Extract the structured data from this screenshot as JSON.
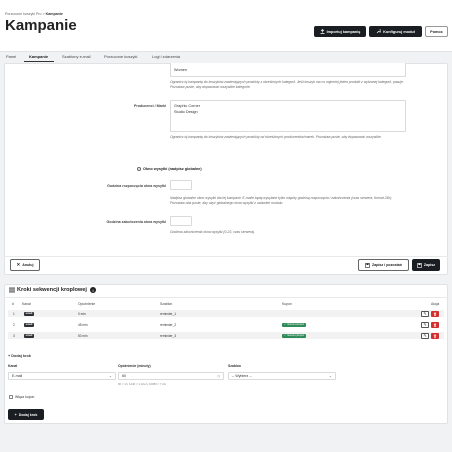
{
  "breadcrumb": {
    "parent": "Porzucone koszyki Pro",
    "separator": ">",
    "current": "Kampanie"
  },
  "page_title": "Kampanie",
  "header_buttons": {
    "import": "Importuj kampanię",
    "configure": "Konfiguruj moduł",
    "help": "Pomoc"
  },
  "tabs": [
    "Panel",
    "Kampanie",
    "Szablony e-mail",
    "Porzucone koszyki",
    "Logi i zdarzenia"
  ],
  "active_tab": 1,
  "form": {
    "categories_value": "Women",
    "categories_help": "Ogranicz tę kampanię do koszyków zawierających produkty z określonych kategorii. Jeśli koszyk ma co najmniej jeden produkt z wybranej kategorii, pasuje. Pozostaw puste, aby dopasować wszystkie kategorie.",
    "manufacturers_label": "Producenci / Marki",
    "manufacturers_values": [
      "Graphic Corner",
      "Studio Design"
    ],
    "manufacturers_help": "Ogranicz tę kampanię do koszyków zawierających produkty od określonych producentów/marek. Pozostaw puste, aby dopasować wszystkie.",
    "send_window_label": "Okno wysyłki (nadpisz globalne)",
    "start_label": "Godzina rozpoczęcia okna wysyłki",
    "start_help": "Nadpisz globalne okno wysyłki dla tej kampanii. E-maile będą wysyłane tylko między godziną rozpoczęcia i zakończenia (czas serwera, format 24h). Pozostaw oba puste, aby użyć globalnego okna wysyłki z ustawień modułu.",
    "end_label": "Godzina zakończenia okna wysyłki",
    "end_help": "Godzina zakończenia okna wysyłki (0-23, czas serwera).",
    "cancel": "Anuluj",
    "save_stay": "Zapisz i pozostań",
    "save": "Zapisz"
  },
  "drip": {
    "title": "Kroki sekwencji kroplowej",
    "columns": [
      "#",
      "Kanał",
      "Opóźnienie",
      "Szablon",
      "Kupon",
      "Akcja"
    ],
    "rows": [
      {
        "num": "1",
        "channel": "email",
        "delay": "0 min",
        "template": "reminder_1",
        "coupon": ""
      },
      {
        "num": "2",
        "channel": "email",
        "delay": "45 min",
        "template": "reminder_2",
        "coupon": "Generuj kupon"
      },
      {
        "num": "3",
        "channel": "email",
        "delay": "50 min",
        "template": "reminder_3",
        "coupon": "Generuj kupon"
      }
    ],
    "add_step_title": "Dodaj krok",
    "channel_label": "Kanał",
    "channel_value": "E-mail",
    "delay_label": "Opóźnienie (minuty)",
    "delay_value": "60",
    "delay_hint": "60 = 1h, 1440 = 1 dzień, 10080 = 7 dni",
    "template_label": "Szablon",
    "template_value": "-- Wybierz --",
    "coupon_checkbox": "Włącz kupon",
    "add_button": "Dodaj krok"
  },
  "colors": {
    "dark": "#1a1d21",
    "danger": "#d32f2f",
    "success": "#2e8b57"
  }
}
